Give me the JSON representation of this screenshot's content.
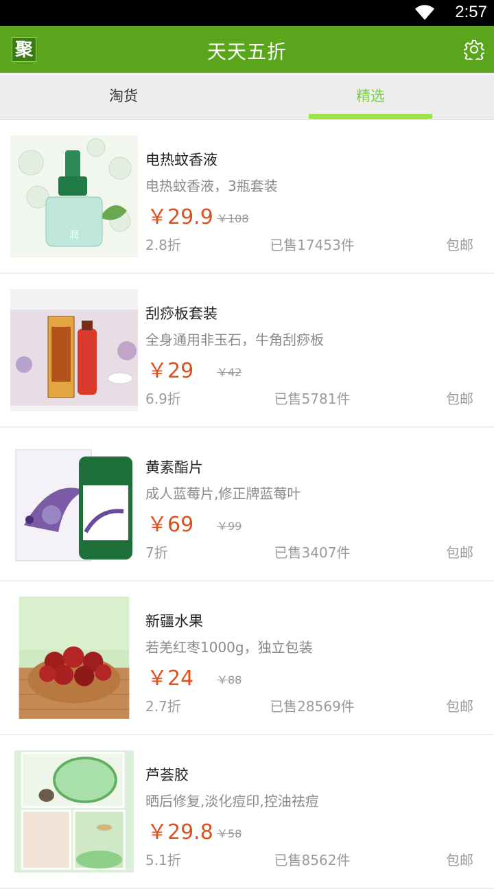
{
  "status": {
    "time": "2:57"
  },
  "header": {
    "logo": "聚",
    "title": "天天五折"
  },
  "tabs": [
    {
      "label": "淘货"
    },
    {
      "label": "精选"
    }
  ],
  "colors": {
    "bar": "#5ba51d",
    "accent": "#9be24d",
    "price": "#e0501e"
  },
  "items": [
    {
      "name": "电热蚊香液",
      "desc": "电热蚊香液，3瓶套装",
      "price": "￥29.9",
      "orig": "￥108",
      "discount": "2.8折",
      "sold": "已售17453件",
      "ship": "包邮",
      "image": "mosquito-liquid-image"
    },
    {
      "name": "刮痧板套装",
      "desc": "全身通用非玉石，牛角刮痧板",
      "price": "￥29",
      "orig": "￥42",
      "discount": "6.9折",
      "sold": "已售5781件",
      "ship": "包邮",
      "image": "scraping-set-image"
    },
    {
      "name": "黄素酯片",
      "desc": "成人蓝莓片,修正牌蓝莓叶",
      "price": "￥69",
      "orig": "￥99",
      "discount": "7折",
      "sold": "已售3407件",
      "ship": "包邮",
      "image": "blueberry-tablet-image"
    },
    {
      "name": "新疆水果",
      "desc": "若羌红枣1000g，独立包装",
      "price": "￥24",
      "orig": "￥88",
      "discount": "2.7折",
      "sold": "已售28569件",
      "ship": "包邮",
      "image": "red-dates-image"
    },
    {
      "name": "芦荟胶",
      "desc": "晒后修复,淡化痘印,控油祛痘",
      "price": "￥29.8",
      "orig": "￥58",
      "discount": "5.1折",
      "sold": "已售8562件",
      "ship": "包邮",
      "image": "aloe-gel-image"
    }
  ]
}
